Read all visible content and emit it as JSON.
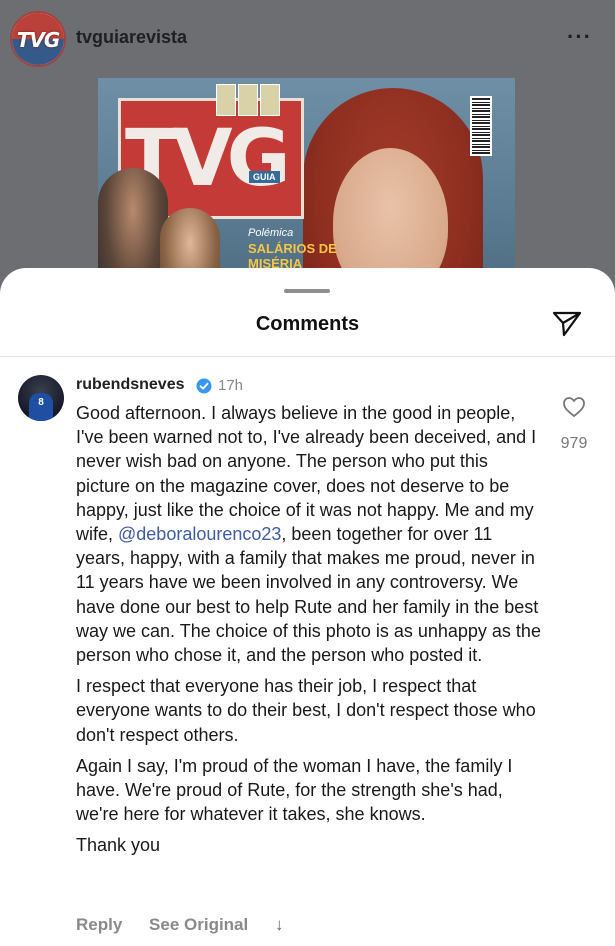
{
  "post": {
    "username": "tvguiarevista",
    "logo_text": "TVG",
    "more_icon": "more-horizontal-icon",
    "magazine": {
      "logo": "TVG",
      "guia_tag": "GUIA",
      "headline_kicker": "Polémica",
      "headline": "SALÁRIOS DE MISÉRIA"
    }
  },
  "sheet": {
    "title": "Comments",
    "share_icon": "send-icon"
  },
  "comment": {
    "username": "rubendsneves",
    "verified_icon": "verified-badge-icon",
    "time": "17h",
    "avatar_number": "8",
    "paragraph1_before": "Good afternoon. I always believe in the good in people, I've been warned not to, I've already been deceived, and I never wish bad on anyone. The person who put this picture on the magazine cover, does not deserve to be happy, just like the choice of it was not happy. Me and my wife, ",
    "mention": "@deboralourenco23",
    "paragraph1_after": ", been together for over 11 years, happy, with a family that makes me proud, never in 11 years have we been involved in any controversy. We have done our best to help Rute and her family in the best way we can. The choice of this photo is as unhappy as the person who chose it, and the person who posted it.",
    "paragraph2": "I respect that everyone has their job, I respect that everyone wants to do their best, I don't respect those who don't respect others.",
    "paragraph3": "Again I say, I'm proud of the woman I have, the family I have. We're proud of Rute, for the strength she's had, we're here for whatever it takes, she knows.",
    "paragraph4": "Thank you",
    "like_icon": "heart-outline-icon",
    "like_count": "979",
    "actions": {
      "reply": "Reply",
      "see_original": "See Original",
      "translate_arrow": "↓"
    }
  }
}
